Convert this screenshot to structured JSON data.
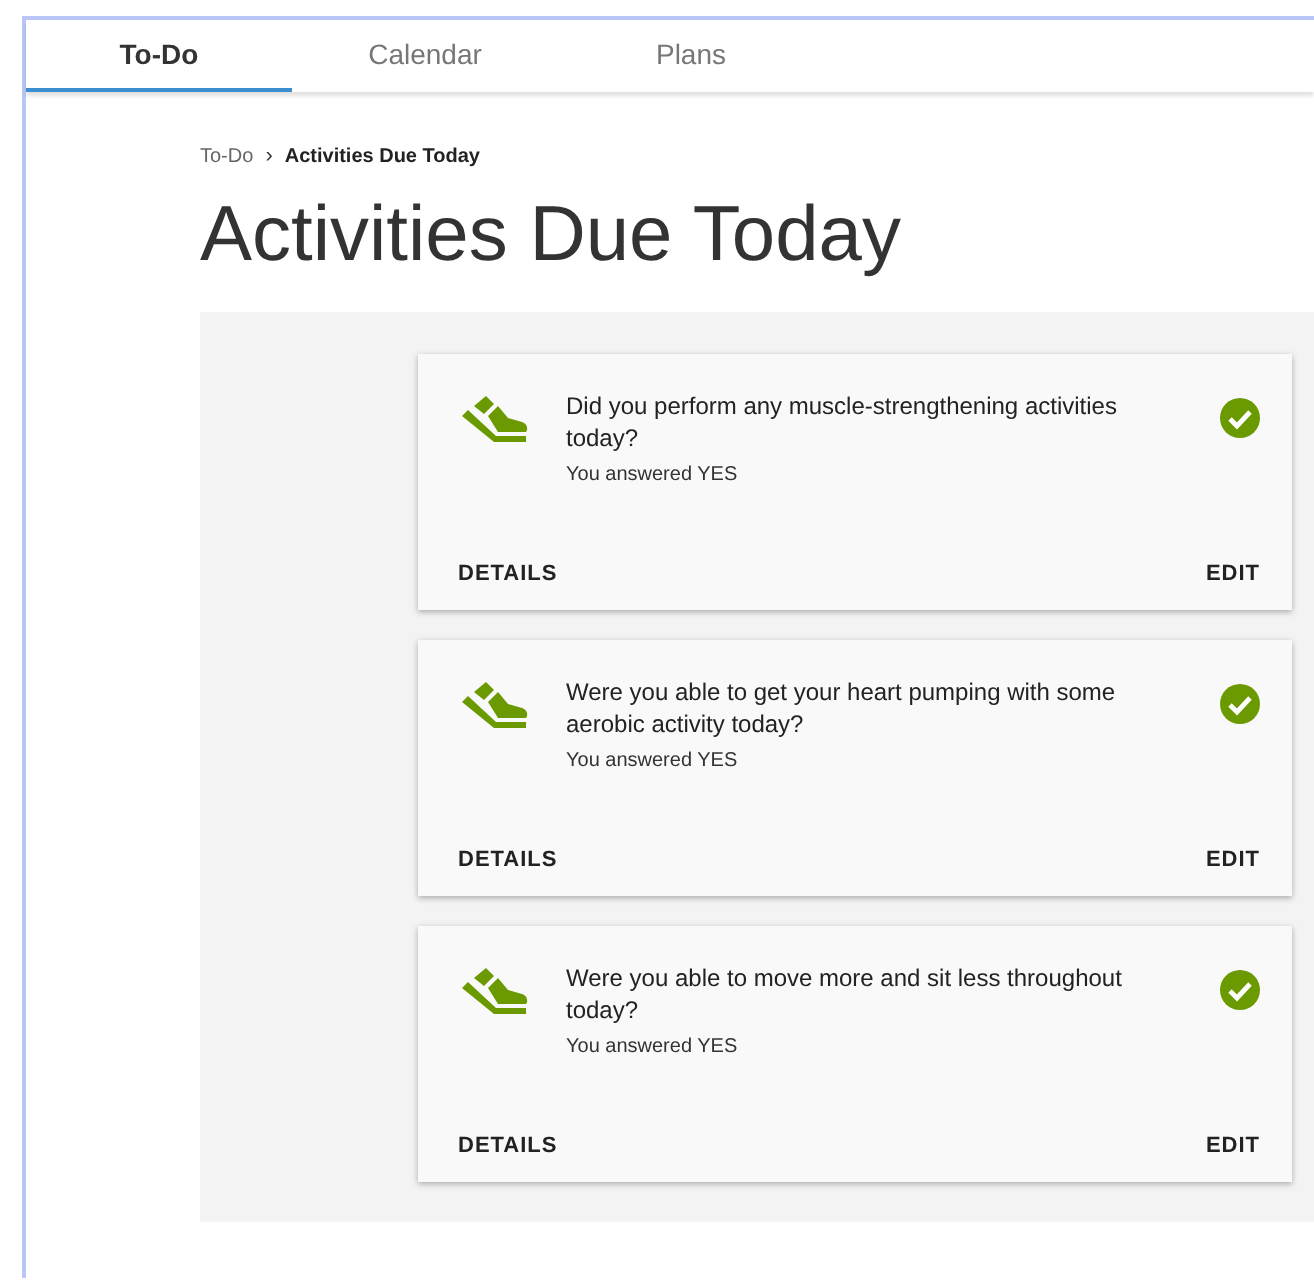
{
  "tabs": [
    {
      "label": "To-Do",
      "selected": true
    },
    {
      "label": "Calendar",
      "selected": false
    },
    {
      "label": "Plans",
      "selected": false
    }
  ],
  "breadcrumb": {
    "parent": "To-Do",
    "separator": "›",
    "current": "Activities Due Today"
  },
  "title": "Activities Due Today",
  "activities": [
    {
      "question": "Did you perform any muscle-strengthening activities today?",
      "answer": "You answered YES",
      "completed": true,
      "details": "DETAILS",
      "edit": "EDIT"
    },
    {
      "question": "Were you able to get your heart pumping with some aerobic activity today?",
      "answer": "You answered YES",
      "completed": true,
      "details": "DETAILS",
      "edit": "EDIT"
    },
    {
      "question": "Were you able to move more and sit less throughout today?",
      "answer": "You answered YES",
      "completed": true,
      "details": "DETAILS",
      "edit": "EDIT"
    }
  ]
}
